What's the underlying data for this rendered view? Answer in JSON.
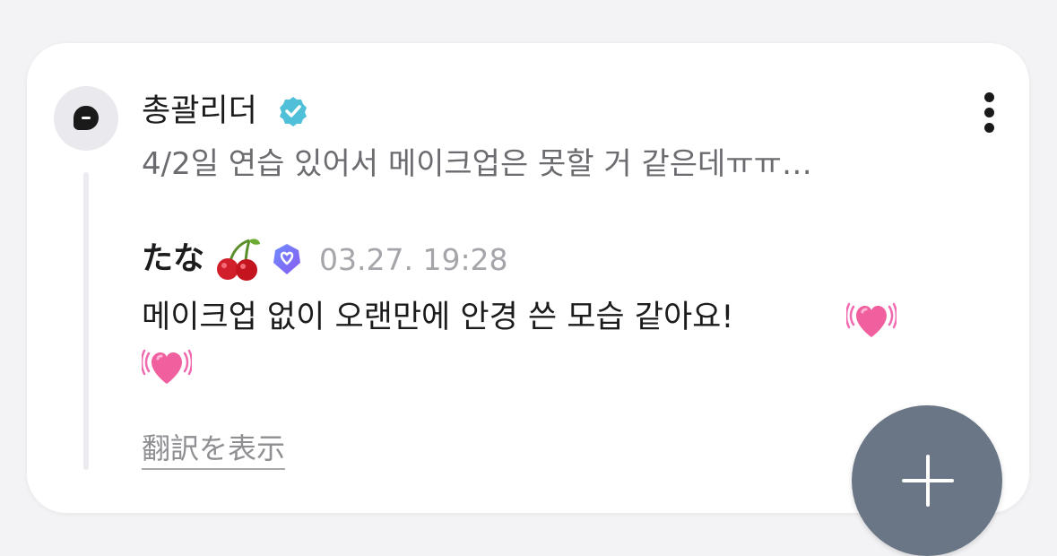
{
  "parent_comment": {
    "author": "총괄리더",
    "text": "4/2일 연습 있어서 메이크업은 못할 거 같은데ㅠㅠ…",
    "verified_icon": "teal-verified-badge-icon"
  },
  "reply": {
    "author": "たな",
    "author_emoji": "cherry-icon",
    "verified_icon": "blue-verified-badge-icon",
    "timestamp": "03.27. 19:28",
    "text": "메이크업 없이 오랜만에 안경 쓴 모습 같아요!",
    "trailing_emojis": [
      "growing-heart-icon",
      "growing-heart-icon"
    ],
    "translate_label": "翻訳を表示"
  },
  "actions": {
    "more_icon": "more-vertical-icon",
    "fab_icon": "plus-icon"
  },
  "colors": {
    "background": "#f3f3f5",
    "card": "#ffffff",
    "teal_badge": "#4fc0d8",
    "blue_badge": "#5b78f0",
    "fab": "#6a7686",
    "muted_text": "#6b6b70",
    "timestamp": "#a5a5aa"
  }
}
